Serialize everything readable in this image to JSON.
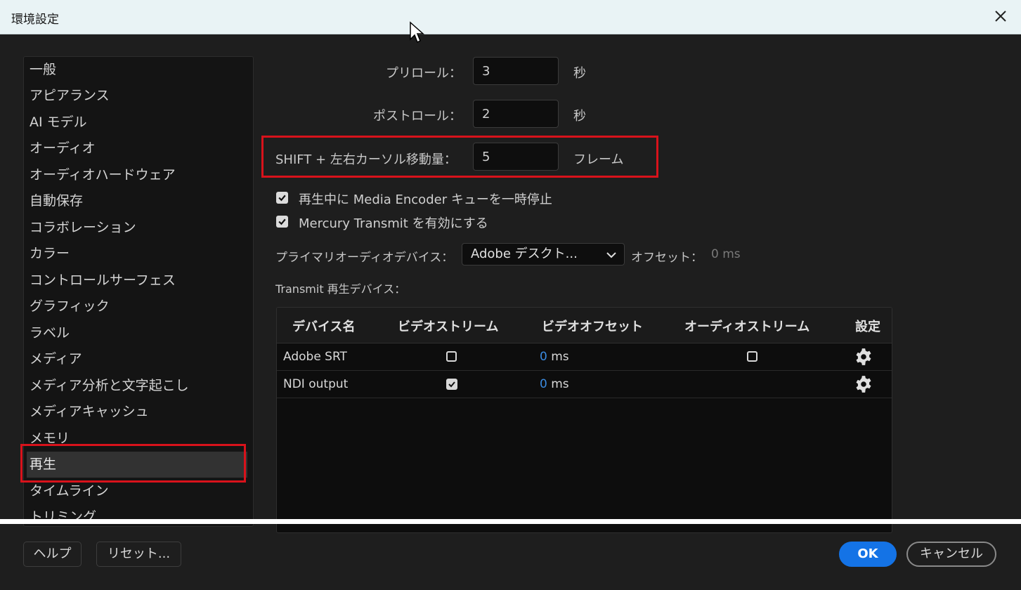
{
  "window": {
    "title": "環境設定"
  },
  "sidebar": {
    "items": [
      {
        "label": "一般"
      },
      {
        "label": "アピアランス"
      },
      {
        "label": "AI モデル"
      },
      {
        "label": "オーディオ"
      },
      {
        "label": "オーディオハードウェア"
      },
      {
        "label": "自動保存"
      },
      {
        "label": "コラボレーション"
      },
      {
        "label": "カラー"
      },
      {
        "label": "コントロールサーフェス"
      },
      {
        "label": "グラフィック"
      },
      {
        "label": "ラベル"
      },
      {
        "label": "メディア"
      },
      {
        "label": "メディア分析と文字起こし"
      },
      {
        "label": "メディアキャッシュ"
      },
      {
        "label": "メモリ"
      },
      {
        "label": "再生"
      },
      {
        "label": "タイムライン"
      },
      {
        "label": "トリミング"
      }
    ],
    "selected_label": "再生"
  },
  "playback": {
    "preroll_label": "プリロール：",
    "preroll_value": "3",
    "preroll_unit": "秒",
    "postroll_label": "ポストロール：",
    "postroll_value": "2",
    "postroll_unit": "秒",
    "shift_label": "SHIFT + 左右カーソル移動量：",
    "shift_value": "5",
    "shift_unit": "フレーム",
    "pause_encoder_label": "再生中に Media Encoder キューを一時停止",
    "pause_encoder_checked": true,
    "mercury_label": "Mercury Transmit を有効にする",
    "mercury_checked": true,
    "primary_audio_label": "プライマリオーディオデバイス：",
    "primary_audio_value": "Adobe デスクト...",
    "offset_label": "オフセット：",
    "offset_value": "0 ms",
    "transmit_devices_label": "Transmit 再生デバイス："
  },
  "devices_table": {
    "headers": [
      "デバイス名",
      "ビデオストリーム",
      "ビデオオフセット",
      "オーディオストリーム",
      "設定"
    ],
    "rows": [
      {
        "name": "Adobe SRT",
        "video_stream": false,
        "video_offset": "0",
        "offset_unit": "ms",
        "audio_stream": false,
        "settings_icon": "gear-icon"
      },
      {
        "name": "NDI output",
        "video_stream": true,
        "video_offset": "0",
        "offset_unit": "ms",
        "audio_stream": null,
        "settings_icon": "gear-icon"
      }
    ]
  },
  "footer": {
    "help_label": "ヘルプ",
    "reset_label": "リセット...",
    "ok_label": "OK",
    "cancel_label": "キャンセル"
  },
  "colors": {
    "accent": "#1473e6",
    "highlight_red": "#d8121b",
    "offset_number": "#3b8be0"
  }
}
